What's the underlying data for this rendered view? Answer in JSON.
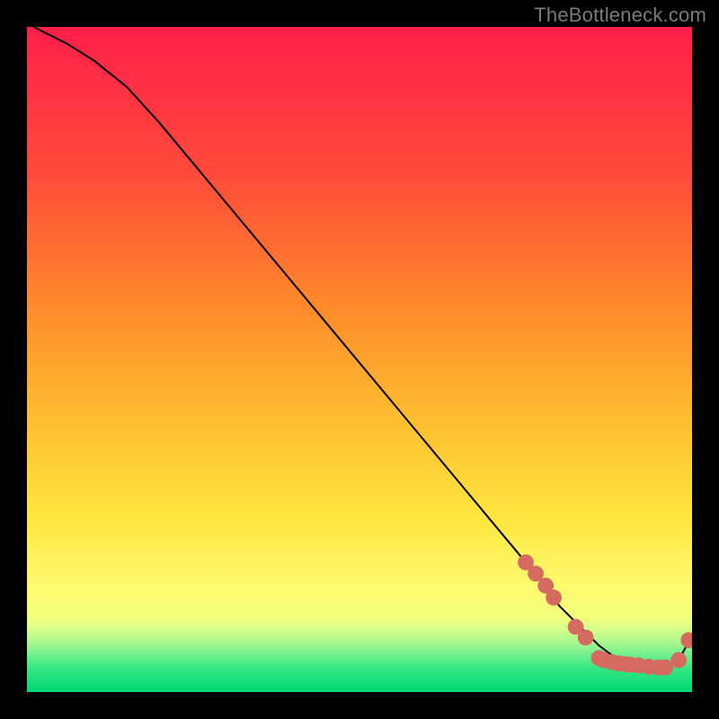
{
  "attribution": "TheBottleneck.com",
  "chart_data": {
    "type": "line",
    "title": "",
    "xlabel": "",
    "ylabel": "",
    "xlim": [
      0,
      100
    ],
    "ylim": [
      0,
      100
    ],
    "grid": false,
    "legend": false,
    "background_gradient": {
      "top": "#ff1f49",
      "mid_upper": "#ff8a2a",
      "mid": "#ffd93a",
      "mid_lower": "#fff86a",
      "green_band_top": "#d7ff8a",
      "bottom": "#00e676"
    },
    "series": [
      {
        "name": "bottleneck-curve",
        "color": "#000000",
        "x": [
          1,
          3,
          6,
          10,
          15,
          20,
          25,
          30,
          35,
          40,
          45,
          50,
          55,
          60,
          65,
          70,
          75,
          78,
          80,
          82,
          84,
          86,
          88,
          90,
          92,
          94,
          96,
          98,
          100
        ],
        "y": [
          100,
          99,
          97.5,
          95,
          91,
          85.5,
          79.5,
          73.5,
          67.5,
          61.5,
          55.5,
          49.5,
          43.5,
          37.5,
          31.5,
          25.5,
          19.5,
          16,
          13,
          11,
          9,
          7,
          5.5,
          4.4,
          3.8,
          3.6,
          3.6,
          4.8,
          8.5
        ]
      }
    ],
    "markers": {
      "name": "highlighted-points",
      "color": "#d46a60",
      "radius": 1.2,
      "points": [
        {
          "x": 75,
          "y": 19.5
        },
        {
          "x": 76.5,
          "y": 17.8
        },
        {
          "x": 78,
          "y": 16
        },
        {
          "x": 79.2,
          "y": 14.2
        },
        {
          "x": 82.5,
          "y": 9.8
        },
        {
          "x": 84,
          "y": 8.2
        },
        {
          "x": 86,
          "y": 5.1
        },
        {
          "x": 86.8,
          "y": 4.8
        },
        {
          "x": 88,
          "y": 4.5
        },
        {
          "x": 89,
          "y": 4.3
        },
        {
          "x": 90,
          "y": 4.2
        },
        {
          "x": 90.8,
          "y": 4.1
        },
        {
          "x": 92,
          "y": 4.0
        },
        {
          "x": 93.5,
          "y": 3.8
        },
        {
          "x": 95,
          "y": 3.7
        },
        {
          "x": 96,
          "y": 3.7
        },
        {
          "x": 98,
          "y": 4.8
        },
        {
          "x": 99.5,
          "y": 7.8
        }
      ]
    }
  }
}
